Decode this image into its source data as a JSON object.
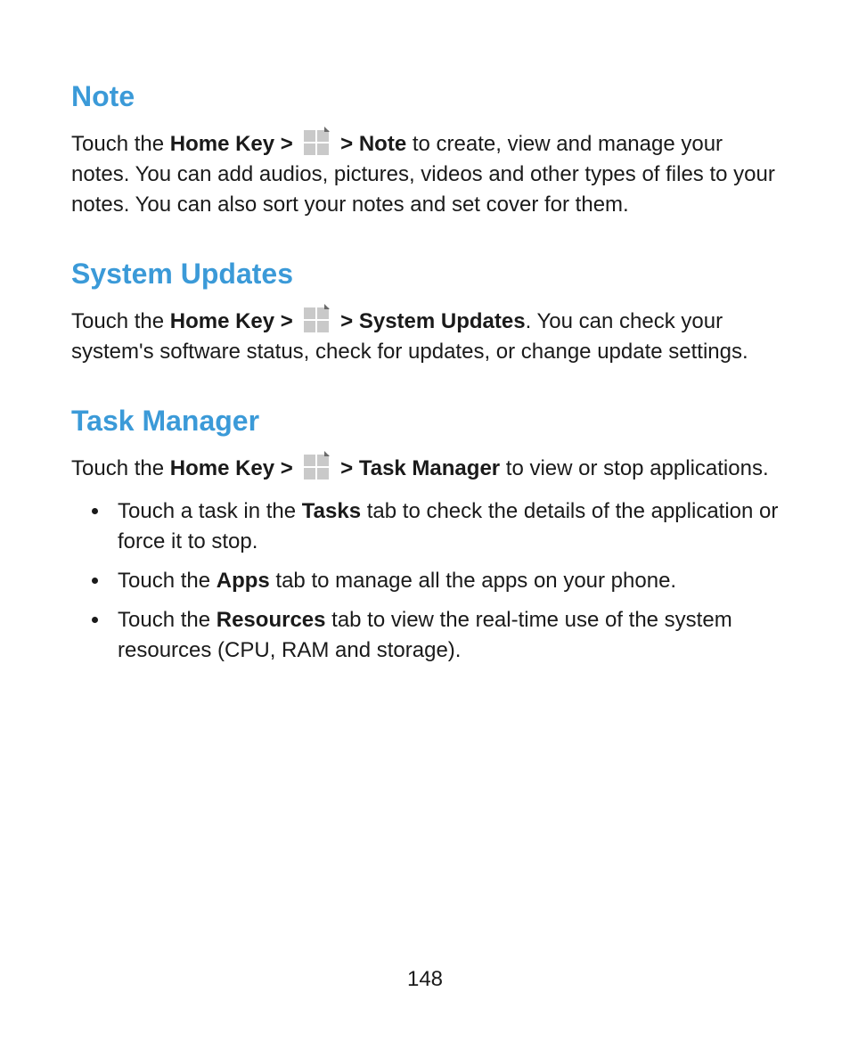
{
  "page_number": "148",
  "sections": [
    {
      "heading": "Note",
      "para": {
        "pre": "Touch the ",
        "bold_path": "Home Key >",
        "mid": " ",
        "bold_target": "> Note",
        "post": " to create, view and manage your notes. You can add audios, pictures, videos and other types of files to your notes. You can also sort your notes and set cover for them."
      }
    },
    {
      "heading": "System Updates",
      "para": {
        "pre": "Touch the ",
        "bold_path": "Home Key >",
        "mid": " ",
        "bold_target": "> System Updates",
        "post": ". You can check your system's software status, check for updates, or change update settings."
      }
    },
    {
      "heading": "Task Manager",
      "para": {
        "pre": "Touch the ",
        "bold_path": "Home Key >",
        "mid": " ",
        "bold_target": "> Task Manager",
        "post": " to view or stop applications."
      },
      "bullets": [
        {
          "pre": "Touch a task in the ",
          "bold": "Tasks",
          "post": " tab to check the details of the application or force it to stop."
        },
        {
          "pre": "Touch the ",
          "bold": "Apps",
          "post": " tab to manage all the apps on your phone."
        },
        {
          "pre": "Touch the ",
          "bold": "Resources",
          "post": " tab to view the real-time use of the system resources (CPU, RAM and storage)."
        }
      ]
    }
  ]
}
